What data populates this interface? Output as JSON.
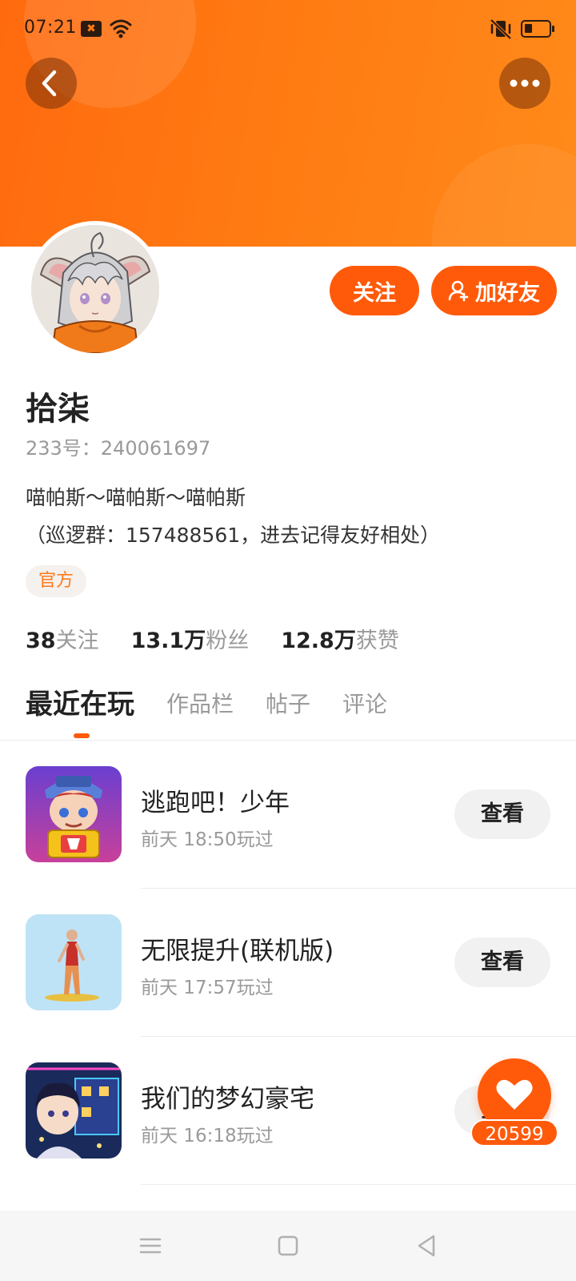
{
  "status_bar": {
    "time": "07:21",
    "notif_glyph": "✖"
  },
  "header": {
    "back_icon": "chevron-left-icon",
    "more_icon": "more-horizontal-icon"
  },
  "actions": {
    "follow_label": "关注",
    "add_friend_label": "加好友"
  },
  "profile": {
    "nickname": "拾柒",
    "account_id": "233号：240061697",
    "bio_line1": "喵帕斯～喵帕斯～喵帕斯",
    "bio_line2": "（巡逻群：157488561，进去记得友好相处）",
    "badge": "官方"
  },
  "stats": [
    {
      "num": "38",
      "label": "关注"
    },
    {
      "num": "13.1万",
      "label": "粉丝"
    },
    {
      "num": "12.8万",
      "label": "获赞"
    }
  ],
  "tabs": [
    {
      "label": "最近在玩",
      "active": true
    },
    {
      "label": "作品栏",
      "active": false
    },
    {
      "label": "帖子",
      "active": false
    },
    {
      "label": "评论",
      "active": false
    }
  ],
  "games": [
    {
      "title": "逃跑吧！少年",
      "time": "前天 18:50玩过",
      "button": "查看"
    },
    {
      "title": "无限提升(联机版)",
      "time": "前天 17:57玩过",
      "button": "查看"
    },
    {
      "title": "我们的梦幻豪宅",
      "time": "前天 16:18玩过",
      "button": "查看"
    }
  ],
  "like": {
    "count": "20599"
  },
  "colors": {
    "accent": "#ff5a0a",
    "banner": "#ff7a12"
  }
}
